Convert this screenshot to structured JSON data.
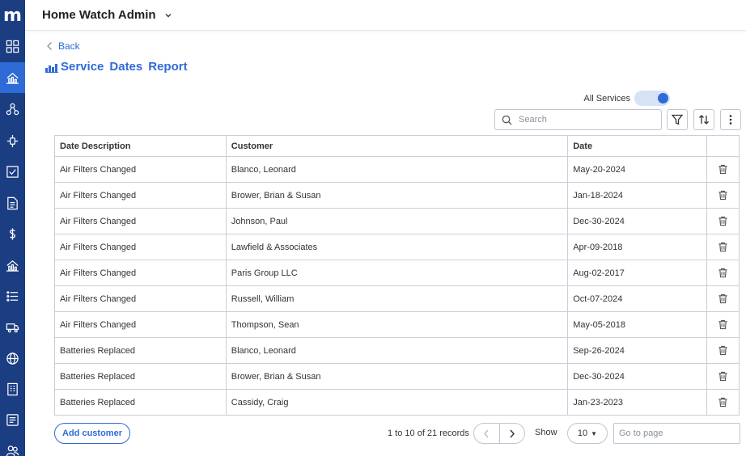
{
  "sidebar": {
    "logo": "m",
    "items": [
      {
        "icon": "dashboard-icon",
        "active": false
      },
      {
        "icon": "house-chart-icon",
        "active": true
      },
      {
        "icon": "network-icon",
        "active": false
      },
      {
        "icon": "sprinkler-icon",
        "active": false
      },
      {
        "icon": "checkbox-icon",
        "active": false
      },
      {
        "icon": "document-icon",
        "active": false
      },
      {
        "icon": "dollar-icon",
        "active": false
      },
      {
        "icon": "house-chart-icon",
        "active": false
      },
      {
        "icon": "list-icon",
        "active": false
      },
      {
        "icon": "truck-icon",
        "active": false
      },
      {
        "icon": "globe-icon",
        "active": false
      },
      {
        "icon": "building-icon",
        "active": false
      },
      {
        "icon": "notes-icon",
        "active": false
      },
      {
        "icon": "users-icon",
        "active": false
      }
    ]
  },
  "header": {
    "title": "Home Watch Admin"
  },
  "back_label": "Back",
  "page_title": {
    "words": [
      "Service",
      "Dates",
      "Report"
    ]
  },
  "toggle": {
    "label": "All Services",
    "on": true
  },
  "search": {
    "placeholder": "Search",
    "value": ""
  },
  "table": {
    "columns": [
      "Date Description",
      "Customer",
      "Date",
      ""
    ],
    "rows": [
      {
        "description": "Air Filters Changed",
        "customer": "Blanco, Leonard",
        "date": "May-20-2024"
      },
      {
        "description": "Air Filters Changed",
        "customer": "Brower, Brian & Susan",
        "date": "Jan-18-2024"
      },
      {
        "description": "Air Filters Changed",
        "customer": "Johnson, Paul",
        "date": "Dec-30-2024"
      },
      {
        "description": "Air Filters Changed",
        "customer": "Lawfield & Associates",
        "date": "Apr-09-2018"
      },
      {
        "description": "Air Filters Changed",
        "customer": "Paris Group LLC",
        "date": "Aug-02-2017"
      },
      {
        "description": "Air Filters Changed",
        "customer": "Russell, William",
        "date": "Oct-07-2024"
      },
      {
        "description": "Air Filters Changed",
        "customer": "Thompson,  Sean",
        "date": "May-05-2018"
      },
      {
        "description": "Batteries Replaced",
        "customer": "Blanco, Leonard",
        "date": "Sep-26-2024"
      },
      {
        "description": "Batteries Replaced",
        "customer": "Brower, Brian & Susan",
        "date": "Dec-30-2024"
      },
      {
        "description": "Batteries Replaced",
        "customer": "Cassidy, Craig",
        "date": "Jan-23-2023"
      }
    ]
  },
  "footer": {
    "add_customer_label": "Add customer",
    "records_text": "1 to 10 of 21 records",
    "show_label": "Show",
    "page_size": "10",
    "goto_placeholder": "Go to page"
  },
  "colors": {
    "sidebar_bg": "#1b3d82",
    "accent": "#2f6bd6"
  }
}
